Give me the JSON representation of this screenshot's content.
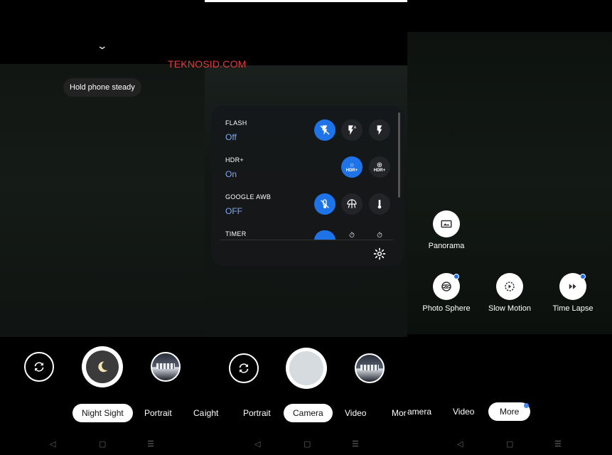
{
  "watermark": "TEKNOSID.COM",
  "panel1": {
    "hint": "Hold phone steady",
    "modes": [
      "Night Sight",
      "Portrait",
      "Ca"
    ],
    "active_mode": "Night Sight"
  },
  "panel2": {
    "settings": [
      {
        "label": "FLASH",
        "value": "Off",
        "options": [
          "flash-off",
          "flash-auto",
          "flash-on"
        ],
        "selected": "flash-off"
      },
      {
        "label": "HDR+",
        "value": "On",
        "options": [
          "HDR+",
          "HDR+"
        ],
        "selected": "HDR+"
      },
      {
        "label": "GOOGLE AWB",
        "value": "OFF",
        "options": [
          "awb-off",
          "awb-auto",
          "awb-manual"
        ],
        "selected": "awb-off"
      },
      {
        "label": "TIMER",
        "value": "",
        "options": [
          "timer-off",
          "timer-3",
          "timer-10"
        ],
        "selected": "timer-off"
      }
    ],
    "modes": [
      "ight",
      "Portrait",
      "Camera",
      "Video",
      "Mor"
    ],
    "active_mode": "Camera"
  },
  "panel3": {
    "more_items": [
      {
        "name": "Panorama",
        "icon": "panorama-icon",
        "new": false
      },
      {
        "name": "Photo Sphere",
        "icon": "photo-sphere-icon",
        "new": true
      },
      {
        "name": "Slow Motion",
        "icon": "slow-motion-icon",
        "new": false
      },
      {
        "name": "Time Lapse",
        "icon": "time-lapse-icon",
        "new": true
      }
    ],
    "modes": [
      "amera",
      "Video",
      "More"
    ],
    "active_mode": "More"
  },
  "nav_icons": [
    "back-icon",
    "home-icon",
    "recents-icon"
  ],
  "colors": {
    "accent": "#1f73e8",
    "value_text": "#7fa9f4",
    "watermark": "#e23b3b"
  }
}
